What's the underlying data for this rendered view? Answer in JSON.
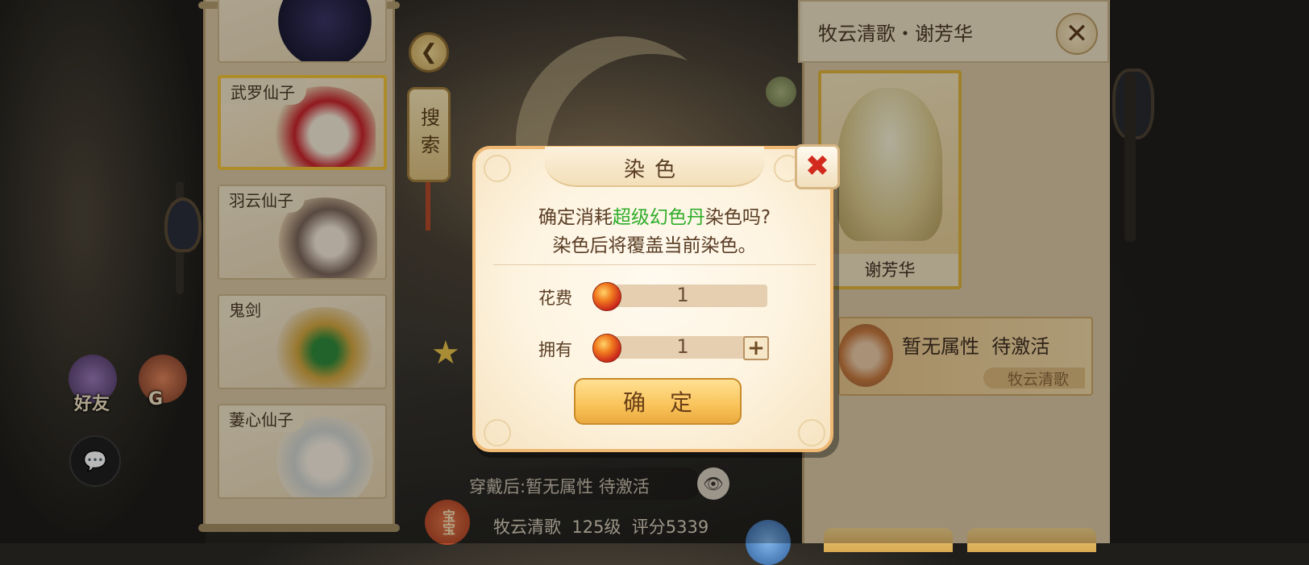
{
  "left_list": {
    "characters": [
      {
        "name": ""
      },
      {
        "name": "武罗仙子",
        "selected": true
      },
      {
        "name": "羽云仙子"
      },
      {
        "name": "鬼剑"
      },
      {
        "name": "萋心仙子"
      }
    ]
  },
  "side_buttons": {
    "search_label": "搜索"
  },
  "hud": {
    "friends_label": "好友",
    "guild_label": "G"
  },
  "bottom_info": {
    "wear_text": "穿戴后:暂无属性 待激活",
    "baobao_label": "宝宝",
    "pet_info": "牧云清歌  125级  评分5339"
  },
  "right_panel": {
    "title": "牧云清歌・谢芳华",
    "skin_name": "谢芳华",
    "attribute_text": "暂无属性  待激活",
    "attribute_source": "牧云清歌"
  },
  "dialog": {
    "title": "染色",
    "message_prefix": "确定消耗",
    "message_highlight": "超级幻色丹",
    "message_suffix": "染色吗?",
    "message_line2": "染色后将覆盖当前染色。",
    "cost_label": "花费",
    "cost_value": "1",
    "owned_label": "拥有",
    "owned_value": "1",
    "confirm_label": "确定",
    "highlight_color": "#2fad2a",
    "close_color": "#d22a1f"
  }
}
